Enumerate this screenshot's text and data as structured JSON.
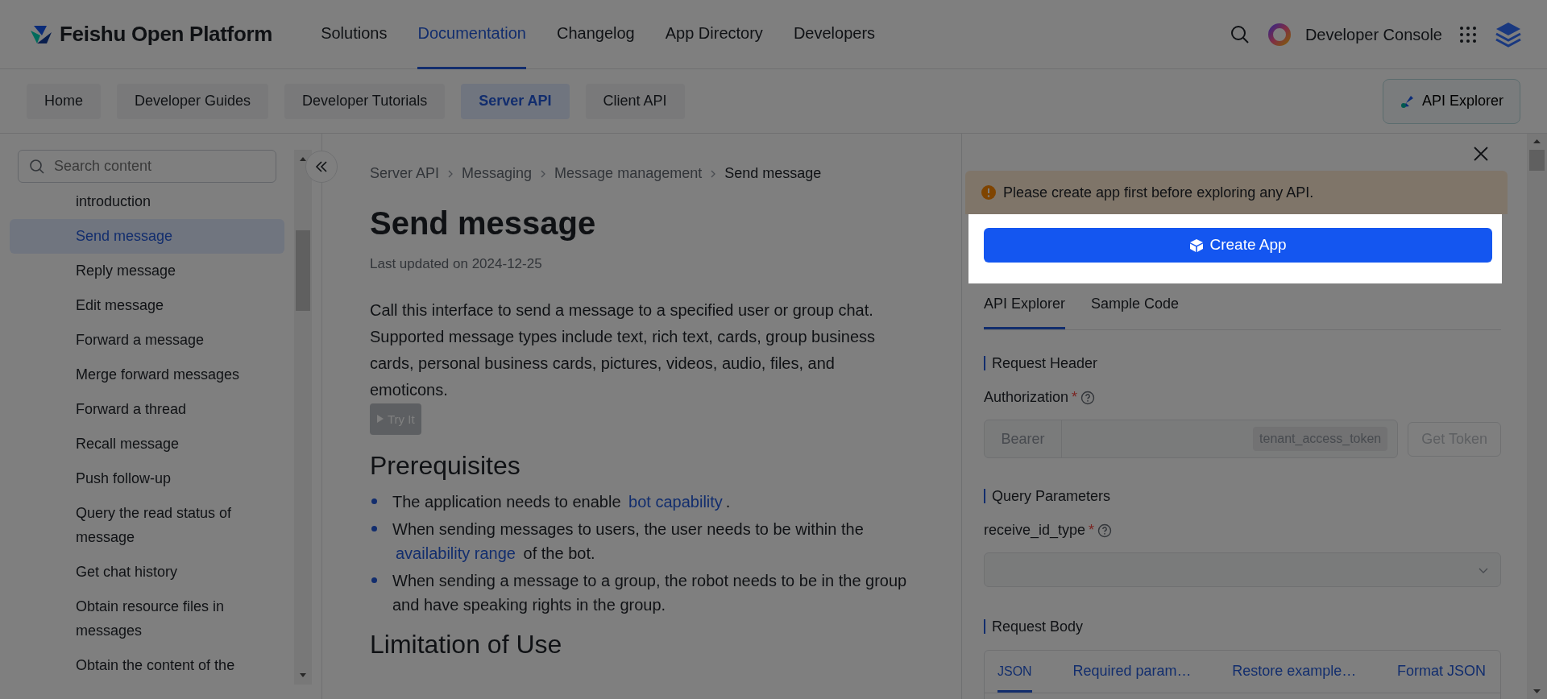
{
  "header": {
    "logo_text": "Feishu Open Platform",
    "nav": [
      {
        "label": "Solutions",
        "selected": false
      },
      {
        "label": "Documentation",
        "selected": true
      },
      {
        "label": "Changelog",
        "selected": false
      },
      {
        "label": "App Directory",
        "selected": false
      },
      {
        "label": "Developers",
        "selected": false
      }
    ],
    "console_label": "Developer Console"
  },
  "subnav": {
    "tabs": [
      {
        "label": "Home",
        "selected": false
      },
      {
        "label": "Developer Guides",
        "selected": false
      },
      {
        "label": "Developer Tutorials",
        "selected": false
      },
      {
        "label": "Server API",
        "selected": true
      },
      {
        "label": "Client API",
        "selected": false
      }
    ],
    "explorer_button": "API Explorer"
  },
  "sidebar": {
    "search_placeholder": "Search content",
    "items": [
      {
        "label": "introduction",
        "selected": false
      },
      {
        "label": "Send message",
        "selected": true
      },
      {
        "label": "Reply message",
        "selected": false
      },
      {
        "label": "Edit message",
        "selected": false
      },
      {
        "label": "Forward a message",
        "selected": false
      },
      {
        "label": "Merge forward messages",
        "selected": false
      },
      {
        "label": "Forward a thread",
        "selected": false
      },
      {
        "label": "Recall message",
        "selected": false
      },
      {
        "label": "Push follow-up",
        "selected": false
      },
      {
        "label": "Query the read status of message",
        "selected": false
      },
      {
        "label": "Get chat history",
        "selected": false
      },
      {
        "label": "Obtain resource files in messages",
        "selected": false
      },
      {
        "label": "Obtain the content of the",
        "selected": false
      }
    ]
  },
  "content": {
    "breadcrumb": [
      "Server API",
      "Messaging",
      "Message management",
      "Send message"
    ],
    "title": "Send message",
    "updated": "Last updated on 2024-12-25",
    "intro": "Call this interface to send a message to a specified user or group chat. Supported message types include text, rich text, cards, group business cards, personal business cards, pictures, videos, audio, files, and emoticons.",
    "try_button": "Try It",
    "heading": "Prerequisites",
    "bullets": [
      [
        {
          "text": "The application needs to enable "
        },
        {
          "link": "bot capability"
        },
        {
          "text": "."
        }
      ],
      [
        {
          "text": "When sending messages to users, the user needs to be within the "
        },
        {
          "link": "availability range"
        },
        {
          "text": " of the bot."
        }
      ],
      [
        {
          "text": "When sending a message to a group, the robot needs to be in the group and have speaking rights in the group."
        }
      ]
    ],
    "next_heading": "Limitation of Use"
  },
  "panel": {
    "alert": "Please create app first before exploring any API.",
    "create_button": "Create App",
    "tabs": [
      {
        "label": "API Explorer",
        "selected": true
      },
      {
        "label": "Sample Code",
        "selected": false
      }
    ],
    "request_header": {
      "title": "Request Header",
      "field_label": "Authorization",
      "required_mark": "*",
      "prefix": "Bearer",
      "token_tag": "tenant_access_token",
      "get_token": "Get Token"
    },
    "query": {
      "title": "Query Parameters",
      "field_label": "receive_id_type",
      "required_mark": "*"
    },
    "body": {
      "title": "Request Body",
      "tabs": [
        {
          "label": "JSON",
          "selected": true
        },
        {
          "label": "Required param…",
          "selected": false
        },
        {
          "label": "Restore example…",
          "selected": false
        },
        {
          "label": "Format JSON",
          "selected": false
        }
      ]
    }
  }
}
